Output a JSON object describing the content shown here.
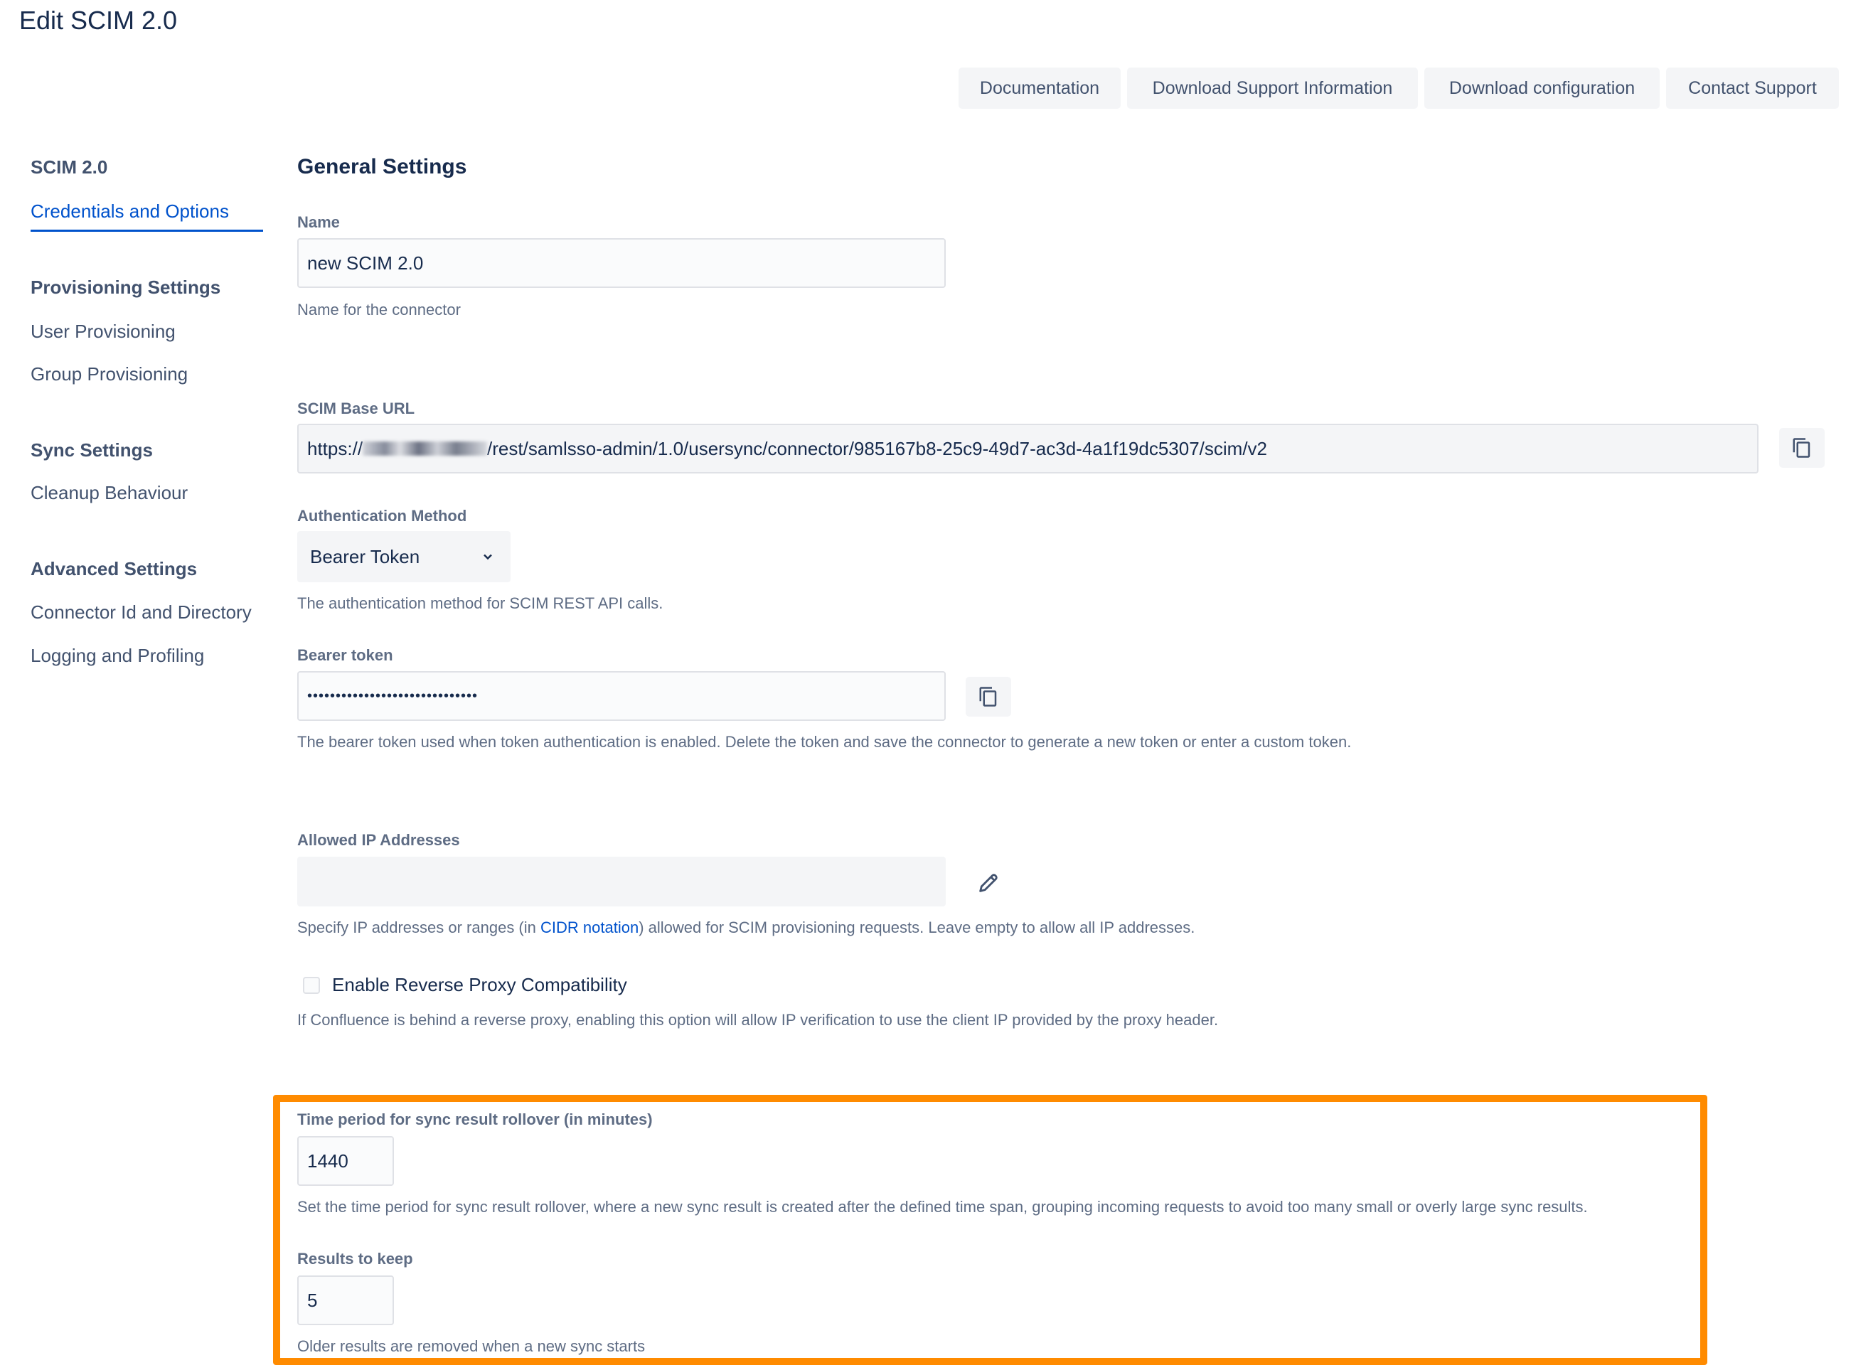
{
  "page": {
    "title": "Edit SCIM 2.0"
  },
  "toolbar": {
    "documentation": "Documentation",
    "download_support": "Download Support Information",
    "download_config": "Download configuration",
    "contact_support": "Contact Support"
  },
  "sidebar": {
    "scim_heading": "SCIM 2.0",
    "credentials": "Credentials and Options",
    "provisioning_heading": "Provisioning Settings",
    "user_provisioning": "User Provisioning",
    "group_provisioning": "Group Provisioning",
    "sync_heading": "Sync Settings",
    "cleanup": "Cleanup Behaviour",
    "advanced_heading": "Advanced Settings",
    "connector_id": "Connector Id and Directory",
    "logging": "Logging and Profiling"
  },
  "form": {
    "section_title": "General Settings",
    "name": {
      "label": "Name",
      "value": "new SCIM 2.0",
      "help": "Name for the connector"
    },
    "base_url": {
      "label": "SCIM Base URL",
      "prefix": "https://",
      "suffix": "/rest/samlsso-admin/1.0/usersync/connector/985167b8-25c9-49d7-ac3d-4a1f19dc5307/scim/v2",
      "copy_icon": "copy-icon"
    },
    "auth_method": {
      "label": "Authentication Method",
      "value": "Bearer Token",
      "help": "The authentication method for SCIM REST API calls.",
      "chevron_icon": "chevron-down-icon"
    },
    "bearer_token": {
      "label": "Bearer token",
      "value": "••••••••••••••••••••••••••••••",
      "help": "The bearer token used when token authentication is enabled. Delete the token and save the connector to generate a new token or enter a custom token.",
      "copy_icon": "copy-icon"
    },
    "allowed_ips": {
      "label": "Allowed IP Addresses",
      "value": "",
      "help_before": "Specify IP addresses or ranges (in ",
      "help_link": "CIDR notation",
      "help_after": ") allowed for SCIM provisioning requests. Leave empty to allow all IP addresses.",
      "edit_icon": "pencil-icon"
    },
    "reverse_proxy": {
      "label": "Enable Reverse Proxy Compatibility",
      "checked": false,
      "help": "If Confluence is behind a reverse proxy, enabling this option will allow IP verification to use the client IP provided by the proxy header."
    },
    "rollover": {
      "label": "Time period for sync result rollover (in minutes)",
      "value": "1440",
      "help": "Set the time period for sync result rollover, where a new sync result is created after the defined time span, grouping incoming requests to avoid too many small or overly large sync results."
    },
    "results_to_keep": {
      "label": "Results to keep",
      "value": "5",
      "help": "Older results are removed when a new sync starts"
    }
  },
  "colors": {
    "highlight": "#ff8b00",
    "link": "#0052cc",
    "text": "#172b4d",
    "muted": "#5e6c84"
  }
}
